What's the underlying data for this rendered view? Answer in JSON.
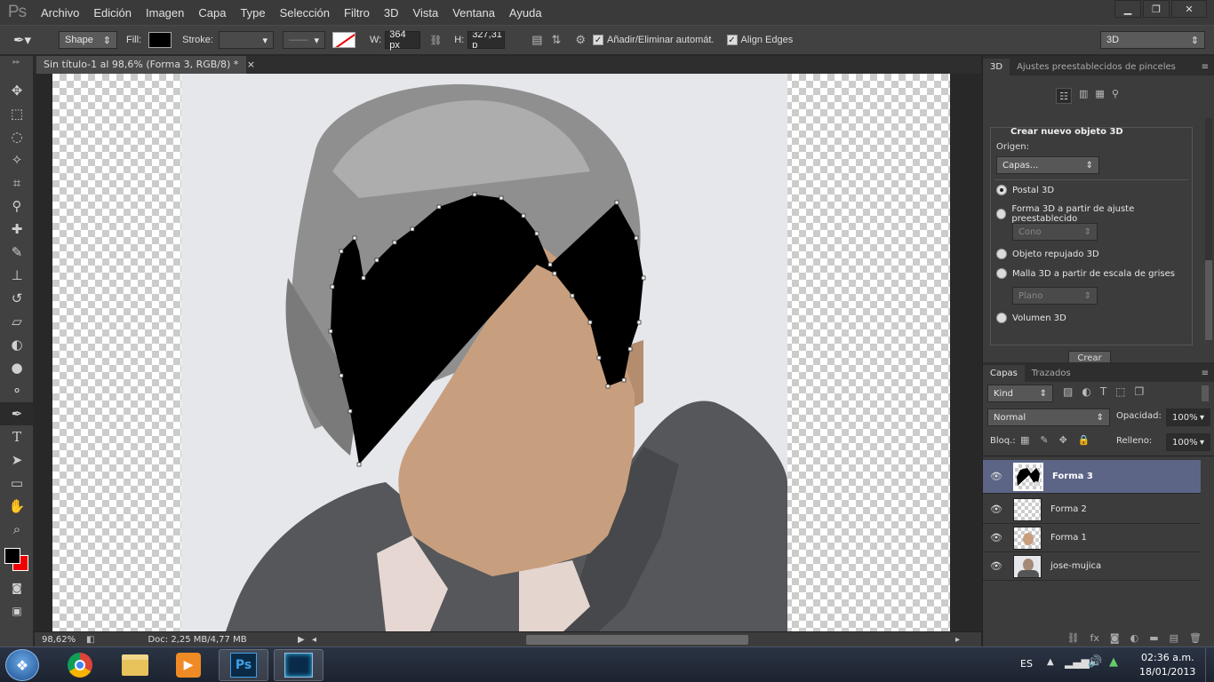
{
  "app": {
    "logo": "Ps"
  },
  "menu": [
    "Archivo",
    "Edición",
    "Imagen",
    "Capa",
    "Type",
    "Selección",
    "Filtro",
    "3D",
    "Vista",
    "Ventana",
    "Ayuda"
  ],
  "window_controls": {
    "minimize": "▁",
    "restore": "❐",
    "close": "✕"
  },
  "options": {
    "mode": "Shape",
    "fill_label": "Fill:",
    "fill_color": "#000000",
    "stroke_label": "Stroke:",
    "w_label": "W:",
    "w_value": "364 px",
    "h_label": "H:",
    "h_value": "327,31 p",
    "auto_add_label": "Añadir/Eliminar automát.",
    "auto_add_checked": true,
    "align_edges_label": "Align Edges",
    "align_edges_checked": true,
    "workspace": "3D"
  },
  "document": {
    "tab_title": "Sin título-1 al 98,6% (Forma 3, RGB/8) *",
    "tab_close": "×"
  },
  "status": {
    "zoom": "98,62%",
    "doc": "Doc: 2,25 MB/4,77 MB"
  },
  "panel3d": {
    "tabs": [
      "3D",
      "Ajustes preestablecidos de pinceles"
    ],
    "section_title": "Crear nuevo objeto 3D",
    "origin_label": "Origen:",
    "origin_value": "Capas...",
    "options": [
      {
        "label": "Postal 3D",
        "selected": true
      },
      {
        "label": "Forma 3D a partir de ajuste preestablecido",
        "selected": false
      },
      {
        "label": "Objeto repujado 3D",
        "selected": false
      },
      {
        "label": "Malla 3D a partir de escala de grises",
        "selected": false
      },
      {
        "label": "Volumen 3D",
        "selected": false
      }
    ],
    "shape_preset": "Cono",
    "grayscale_preset": "Plano",
    "create_button": "Crear"
  },
  "layers_panel": {
    "tabs": [
      "Capas",
      "Trazados"
    ],
    "filter": "Kind",
    "blend_mode": "Normal",
    "opacity_label": "Opacidad:",
    "opacity": "100%",
    "lock_label": "Bloq.:",
    "fill_label": "Relleno:",
    "fill": "100%",
    "layers": [
      {
        "name": "Forma 3",
        "selected": true
      },
      {
        "name": "Forma 2",
        "selected": false
      },
      {
        "name": "Forma 1",
        "selected": false
      },
      {
        "name": "jose-mujica",
        "selected": false
      }
    ]
  },
  "taskbar": {
    "language": "ES",
    "time": "02:36 a.m.",
    "date": "18/01/2013"
  },
  "colors": {
    "face": "#c89f7e",
    "shape_black": "#000000",
    "background_photo": "#e7e8ec",
    "selected_layer": "#5c6585",
    "foreground": "#000000",
    "background_swatch": "#ff0000"
  }
}
